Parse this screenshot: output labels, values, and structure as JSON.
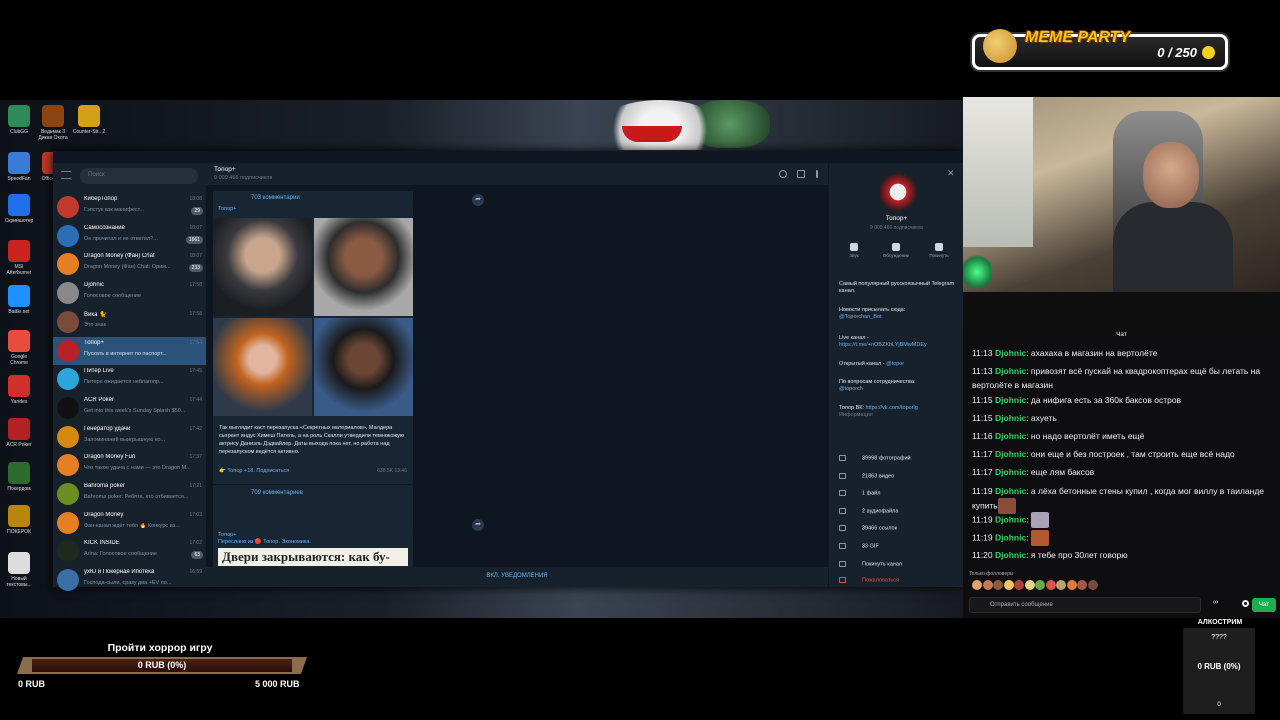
{
  "overlay": {
    "meme_title": "MEME PARTY",
    "meme_count": "0 / 250"
  },
  "desktop_icons": [
    {
      "label": "ClubGG"
    },
    {
      "label": "Ведьмак 3 Дикая Охота"
    },
    {
      "label": "Counter-Str.. 2"
    },
    {
      "label": "SpeedFan"
    },
    {
      "label": "Office M..."
    },
    {
      "label": "Скриншотер"
    },
    {
      "label": "MSI Afterburner"
    },
    {
      "label": "Battle.net"
    },
    {
      "label": "Google Chrome"
    },
    {
      "label": "Yandex"
    },
    {
      "label": "ACR Poker"
    },
    {
      "label": "Покердом"
    },
    {
      "label": "ПОКЕРОК"
    },
    {
      "label": "Новый текстовы..."
    }
  ],
  "telegram": {
    "search_placeholder": "Поиск",
    "chats": [
      {
        "name": "КиберТопор",
        "preview": "Гэпстук как манифест...",
        "time": "18:08",
        "badge": "29",
        "color": "#c0392b"
      },
      {
        "name": "Самосознание",
        "preview": "Он прочитал и не ответил?...",
        "time": "18:07",
        "badge": "1661",
        "color": "#2c6eb5"
      },
      {
        "name": "Dragon Money (Фан) Chat",
        "preview": "Dragon Money (Фан) Chat: Орим...",
        "time": "18:07",
        "badge": "233",
        "color": "#e67e22"
      },
      {
        "name": "Djohnic",
        "preview": "Голосовое сообщение",
        "time": "17:58",
        "badge": "",
        "color": "#888888"
      },
      {
        "name": "Вика 🐈",
        "preview": "Это знак",
        "time": "17:58",
        "badge": "",
        "color": "#7a4b3a"
      },
      {
        "name": "Топор+",
        "preview": "Пускать в интернет по паспорт...",
        "time": "17:54",
        "badge": "",
        "color": "#b8202a"
      },
      {
        "name": "Питер Live",
        "preview": "Питере ожидается неблагопр...",
        "time": "17:45",
        "badge": "",
        "color": "#2aa7d8"
      },
      {
        "name": "ACR Poker",
        "preview": "Get into this week's Sunday Splash $50...",
        "time": "17:44",
        "badge": "",
        "color": "#111111"
      },
      {
        "name": "Генератор удачи",
        "preview": "Запоминаний выигрышную ко...",
        "time": "17:42",
        "badge": "",
        "color": "#d68910"
      },
      {
        "name": "Dragon Money Fun",
        "preview": "Что такое удача с нами — это Dragon M...",
        "time": "17:37",
        "badge": "",
        "color": "#e67e22"
      },
      {
        "name": "Bahroma poker",
        "preview": "Bahroma poker: Ребята, кто отбивается...",
        "time": "17:21",
        "badge": "",
        "color": "#6b8e23"
      },
      {
        "name": "Dragon Money",
        "preview": "Фан-канал ждёт тебя 🔥 Конкурс из...",
        "time": "17:03",
        "badge": "",
        "color": "#e67e22"
      },
      {
        "name": "KICK INSIDE",
        "preview": "Arina: Голосовое сообщение",
        "time": "17:02",
        "badge": "63",
        "color": "#1e2a1e"
      },
      {
        "name": "ухЮ и Покерная Ипотека",
        "preview": "Господа-сыли, сразу два +EV по...",
        "time": "16:59",
        "badge": "",
        "color": "#3b6ea5"
      }
    ],
    "channel_title": "Топор+",
    "channel_subscribers": "9 009 466 подписчиков",
    "comments_top": "703 комментарии",
    "post_label": "Топор+",
    "post_text": "Так выглядит каст перезапуска «Секретных материалов». Малдера сыграет индус Химеш Патель, а на роль Скалли утвердили темнокожую актрису Даниэль Дэдвайлер. Даты выхода пока нет, но работа над перезапуском ведётся активно.",
    "post_link": "👉 Топор +18. Подписаться",
    "post_views": "638.5K 13:46",
    "post_comments": "709 комментариев",
    "post2_author": "Топор+",
    "post2_forward": "Переслано из 🔴 Топор. Экономика.",
    "post2_headline": "Двери закрываются: как бу-",
    "notify_button": "ВКЛ. УВЕДОМЛЕНИЯ",
    "info": {
      "name": "Топор+",
      "subscribers": "9 009 466 подписчиков",
      "btn_sound": "Звук",
      "btn_discuss": "Обсуждение",
      "btn_leave": "Покинуть",
      "desc": "Самый популярный русскоязычный Telegram канал.",
      "news_label": "Новости присылать сюда:",
      "news_link": "@Toporchan_Bot",
      "live_label": "Live канал -",
      "live_link": "https://t.me/+nOBZXbLYjBMwMDEy",
      "open_label": "Открытый канал -",
      "open_link": "@topor",
      "coop_label": "По вопросам сотрудничества:",
      "coop_link": "@toporch",
      "vk_label": "Топор ВК:",
      "vk_link": "https://vk.com/toporlg",
      "info_caption": "Информация",
      "stats": [
        "39998 фотографий",
        "21863 видео",
        "1 файл",
        "2 аудиофайла",
        "39466 ссылок",
        "33 GIF"
      ],
      "leave_channel": "Покинуть канал",
      "report": "Пожаловаться"
    }
  },
  "stream_chat": {
    "header": "Чат",
    "messages": [
      {
        "time": "11:13",
        "user": "Djohnic",
        "text": "ахахаха в магазин на вертолёте"
      },
      {
        "time": "11:13",
        "user": "Djohnic",
        "text": "привозят всё пускай на квадрокоптерах ещё бы летать на вертолёте в магазин"
      },
      {
        "time": "11:15",
        "user": "Djohnic",
        "text": "да нифига есть за 360к баксов остров"
      },
      {
        "time": "11:15",
        "user": "Djohnic",
        "text": "ахуеть"
      },
      {
        "time": "11:16",
        "user": "Djohnic",
        "text": "но надо вертолёт иметь ещё"
      },
      {
        "time": "11:17",
        "user": "Djohnic",
        "text": "они еще и без построек , там строить еще всё надо"
      },
      {
        "time": "11:17",
        "user": "Djohnic",
        "text": "еще лям баксов"
      },
      {
        "time": "11:19",
        "user": "Djohnic",
        "text": "а лёха бетонные стены купил , когда мог виллу в таиланде купить"
      },
      {
        "time": "11:19",
        "user": "Djohnic",
        "text": ""
      },
      {
        "time": "11:19",
        "user": "Djohnic",
        "text": ""
      },
      {
        "time": "11:20",
        "user": "Djohnic",
        "text": "я тебе про 30лет говорю"
      }
    ],
    "followers_only": "Только фолловеры",
    "input_placeholder": "Отправить сообщение",
    "points": "∞",
    "send_button": "Чат"
  },
  "goal": {
    "title": "Пройти хоррор игру",
    "current": "0 RUB (0%)",
    "min": "0 RUB",
    "max": "5 000 RUB",
    "progress": 0
  },
  "alkostream": {
    "title": "АЛКОСТРИМ",
    "question": "????",
    "value": "0 RUB (0%)",
    "zero": "0"
  }
}
